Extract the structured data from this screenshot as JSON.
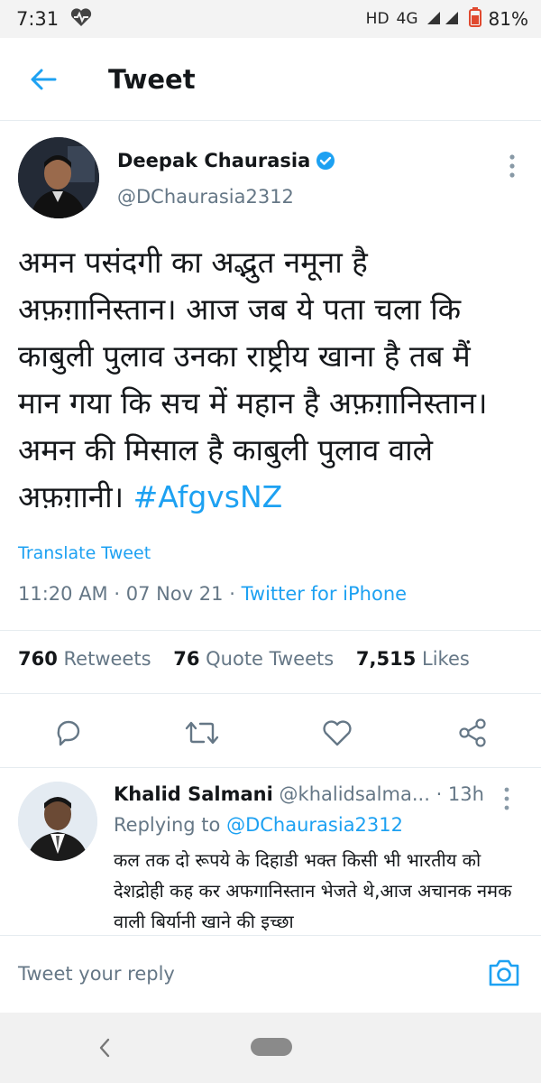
{
  "status_bar": {
    "time": "7:31",
    "network": "HD",
    "signal_type": "4G",
    "battery_percent": "81%"
  },
  "header": {
    "title": "Tweet"
  },
  "tweet": {
    "author_name": "Deepak Chaurasia",
    "author_handle": "@DChaurasia2312",
    "verified": true,
    "text_lines": [
      "अमन पसंदगी का अद्भुत नमूना है",
      "अफ़ग़ानिस्तान। आज जब ये पता चला कि",
      "काबुली पुलाव उनका राष्ट्रीय खाना है तब मैं",
      "मान गया कि सच में महान है अफ़ग़ानिस्तान।",
      "अमन की मिसाल है काबुली पुलाव वाले",
      "अफ़ग़ानी।"
    ],
    "hashtag": "#AfgvsNZ",
    "translate_label": "Translate Tweet",
    "time": "11:20 AM",
    "date": "07 Nov 21",
    "source": "Twitter for iPhone",
    "retweets_count": "760",
    "retweets_label": "Retweets",
    "quote_count": "76",
    "quote_label": "Quote Tweets",
    "likes_count": "7,515",
    "likes_label": "Likes"
  },
  "actions": {
    "icons": [
      "reply-icon",
      "retweet-icon",
      "like-icon",
      "share-icon"
    ]
  },
  "reply": {
    "name": "Khalid Salmani",
    "handle": "@khalidsalma...",
    "time": "13h",
    "replying_label": "Replying to",
    "replying_to": "@DChaurasia2312",
    "text": "कल तक दो रूपये के दिहाडी भक्त किसी भी भारतीय को देशद्रोही कह कर अफगानिस्तान भेजते थे,आज अचानक नमक वाली बिर्यानी खाने की इच्छा"
  },
  "compose": {
    "placeholder": "Tweet your reply"
  },
  "colors": {
    "accent": "#1da1f2",
    "text": "#14171a",
    "secondary": "#657786"
  }
}
